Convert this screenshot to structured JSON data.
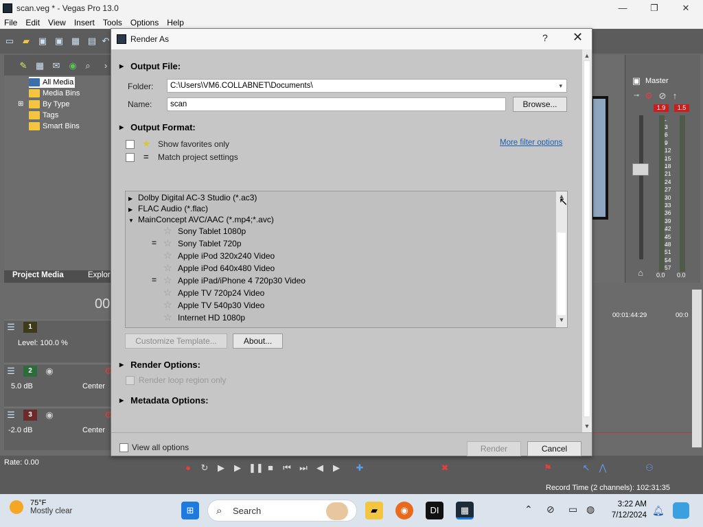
{
  "window": {
    "title": "scan.veg * - Vegas Pro 13.0",
    "controls": {
      "minimize": "—",
      "maximize": "❐",
      "close": "✕"
    }
  },
  "menu": [
    "File",
    "Edit",
    "View",
    "Insert",
    "Tools",
    "Options",
    "Help"
  ],
  "media_panel": {
    "tree": [
      "All Media",
      "Media Bins",
      "By Type",
      "Tags",
      "Smart Bins"
    ],
    "tabs": [
      "Project Media",
      "Explor"
    ]
  },
  "master": {
    "label": "Master",
    "peak_left": "1.9",
    "peak_right": "1.5",
    "db_marks": [
      "3",
      "6",
      "9",
      "12",
      "15",
      "18",
      "21",
      "24",
      "27",
      "30",
      "33",
      "36",
      "39",
      "42",
      "45",
      "48",
      "51",
      "54",
      "57"
    ],
    "level_left": "0.0",
    "level_right": "0.0"
  },
  "timeline": {
    "timecode_partial": "00",
    "level": "Level: 100.0 %",
    "tracks": [
      {
        "num": "1",
        "color": "#3c3c1a",
        "vol": "",
        "pan": ""
      },
      {
        "num": "2",
        "color": "#2c6b3a",
        "vol": "5.0 dB",
        "pan": "Center"
      },
      {
        "num": "3",
        "color": "#6b2b2b",
        "vol": "-2.0 dB",
        "pan": "Center"
      }
    ],
    "ruler_times": [
      "00:01:44:29",
      "00:0"
    ],
    "rate": "Rate: 0.00",
    "record_time": "Record Time (2 channels): 102:31:35"
  },
  "dialog": {
    "title": "Render As",
    "help": "?",
    "close": "✕",
    "output_file": {
      "header": "Output File:",
      "folder_label": "Folder:",
      "folder_value": "C:\\Users\\VM6.COLLABNET\\Documents\\",
      "name_label": "Name:",
      "name_value": "scan",
      "browse": "Browse..."
    },
    "output_format": {
      "header": "Output Format:",
      "show_favorites": "Show favorites only",
      "match_project": "Match project settings",
      "more_filter": "More filter options",
      "formats": [
        {
          "label": "Dolby Digital AC-3 Studio (*.ac3)",
          "expanded": false
        },
        {
          "label": "FLAC Audio (*.flac)",
          "expanded": false
        },
        {
          "label": "MainConcept AVC/AAC (*.mp4;*.avc)",
          "expanded": true
        }
      ],
      "templates": [
        {
          "label": "Sony Tablet 1080p",
          "match": false
        },
        {
          "label": "Sony Tablet 720p",
          "match": true
        },
        {
          "label": "Apple iPod 320x240 Video",
          "match": false
        },
        {
          "label": "Apple iPod 640x480 Video",
          "match": false
        },
        {
          "label": "Apple iPad/iPhone 4 720p30 Video",
          "match": true
        },
        {
          "label": "Apple TV 720p24 Video",
          "match": false
        },
        {
          "label": "Apple TV 540p30 Video",
          "match": false
        },
        {
          "label": "Internet HD 1080p",
          "match": false
        }
      ],
      "customize": "Customize Template...",
      "about": "About..."
    },
    "render_options": {
      "header": "Render Options:",
      "loop_region": "Render loop region only"
    },
    "metadata_options": {
      "header": "Metadata Options:"
    },
    "footer": {
      "view_all": "View all options",
      "render": "Render",
      "cancel": "Cancel"
    }
  },
  "taskbar": {
    "weather_temp": "75°F",
    "weather_desc": "Mostly clear",
    "search": "Search",
    "time": "3:22 AM",
    "date": "7/12/2024"
  },
  "colors": {
    "accent": "#1a5fb4",
    "peak": "#c81e1e",
    "folder": "#f2c641"
  }
}
